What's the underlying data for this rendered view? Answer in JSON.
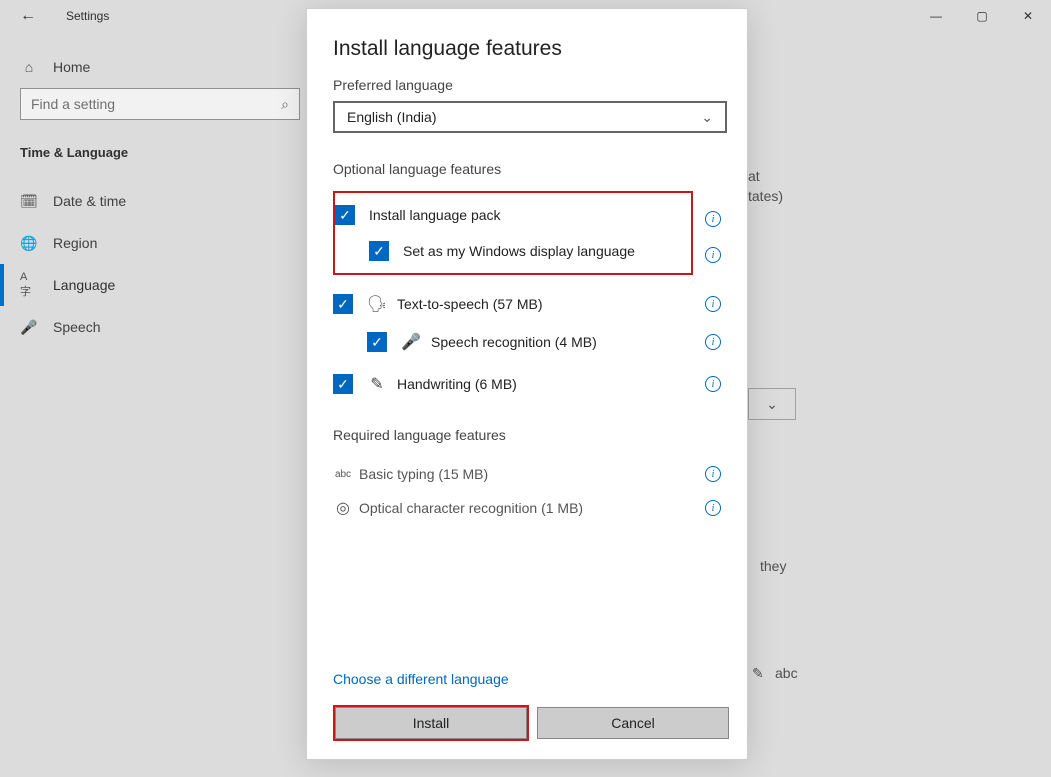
{
  "window": {
    "title": "Settings",
    "minimize": "—",
    "maximize": "▢",
    "close": "✕"
  },
  "sidebar": {
    "home": "Home",
    "search_placeholder": "Find a setting",
    "section": "Time & Language",
    "items": [
      {
        "icon": "📅",
        "label": "Date & time"
      },
      {
        "icon": "🌐",
        "label": "Region"
      },
      {
        "icon": "A字",
        "label": "Language"
      },
      {
        "icon": "🎤",
        "label": "Speech"
      }
    ]
  },
  "background": {
    "line1": "at",
    "line2": "tates)",
    "line3": "they"
  },
  "dialog": {
    "title": "Install language features",
    "preferred_label": "Preferred language",
    "preferred_value": "English (India)",
    "optional_label": "Optional language features",
    "features": {
      "install_pack": "Install language pack",
      "set_display": "Set as my Windows display language",
      "tts": "Text-to-speech (57 MB)",
      "speech_rec": "Speech recognition (4 MB)",
      "handwriting": "Handwriting (6 MB)"
    },
    "required_label": "Required language features",
    "required": {
      "basic_typing": "Basic typing (15 MB)",
      "ocr": "Optical character recognition (1 MB)"
    },
    "choose_different": "Choose a different language",
    "install_btn": "Install",
    "cancel_btn": "Cancel"
  }
}
